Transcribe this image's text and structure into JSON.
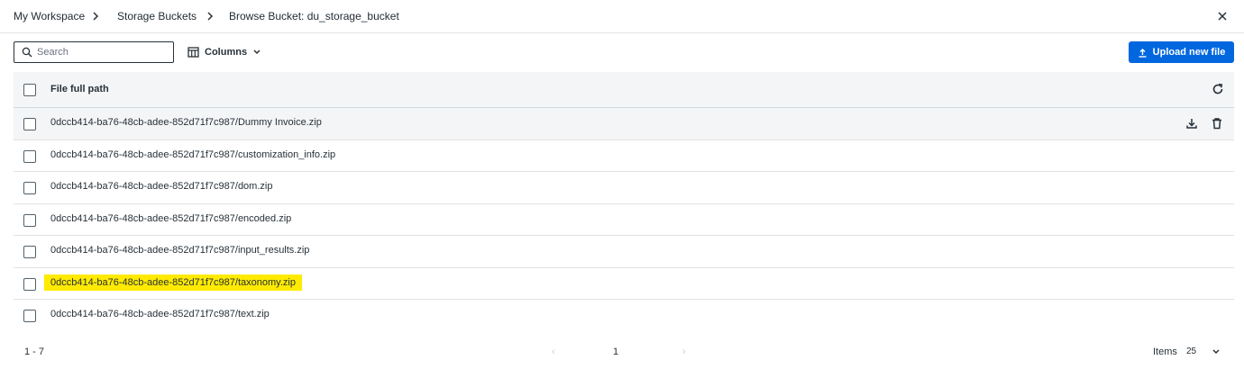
{
  "breadcrumb": {
    "items": [
      "My Workspace",
      "Storage Buckets",
      "Browse Bucket: du_storage_bucket"
    ]
  },
  "toolbar": {
    "search_placeholder": "Search",
    "columns_label": "Columns",
    "upload_label": "Upload new file"
  },
  "table": {
    "header": "File full path",
    "rows": [
      "0dccb414-ba76-48cb-adee-852d71f7c987/Dummy Invoice.zip",
      "0dccb414-ba76-48cb-adee-852d71f7c987/customization_info.zip",
      "0dccb414-ba76-48cb-adee-852d71f7c987/dom.zip",
      "0dccb414-ba76-48cb-adee-852d71f7c987/encoded.zip",
      "0dccb414-ba76-48cb-adee-852d71f7c987/input_results.zip",
      "0dccb414-ba76-48cb-adee-852d71f7c987/taxonomy.zip",
      "0dccb414-ba76-48cb-adee-852d71f7c987/text.zip"
    ]
  },
  "footer": {
    "range": "1 - 7",
    "prev": "‹",
    "page": "1",
    "next": "›",
    "items_label": "Items",
    "items_per_page": "25"
  },
  "colors": {
    "accent": "#0067df",
    "highlight": "#ffea00",
    "hover_row": "#f4f5f7"
  },
  "icons": [
    "chevron-right-icon",
    "close-icon",
    "search-icon",
    "columns-icon",
    "chevron-down-icon",
    "upload-icon",
    "refresh-icon",
    "download-icon",
    "delete-icon"
  ]
}
